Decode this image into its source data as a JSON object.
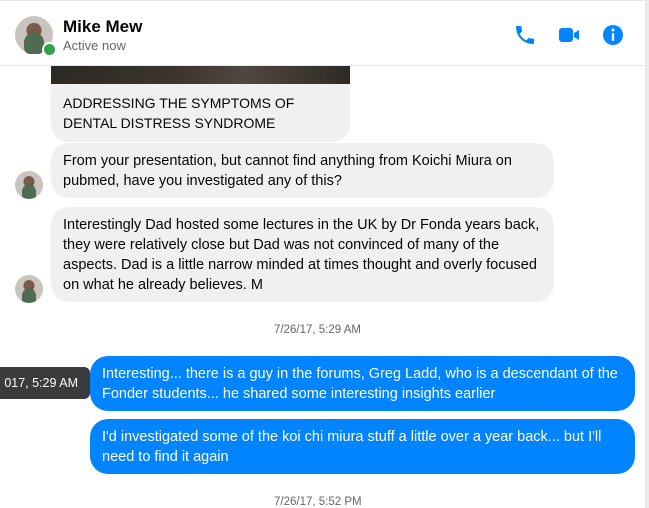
{
  "header": {
    "name": "Mike Mew",
    "status": "Active now",
    "icons": {
      "call": "phone-icon",
      "video": "video-camera-icon",
      "info": "info-icon"
    },
    "accent_color": "#0084ff"
  },
  "messages": {
    "shared_link_caption": "ADDRESSING THE SYMPTOMS OF DENTAL DISTRESS SYNDROME",
    "msg1": "From your presentation, but cannot find anything from Koichi Miura on pubmed, have you investigated any of this?",
    "msg2": "Interestingly Dad hosted some lectures in the UK by Dr Fonda years back, they were relatively close but Dad was not convinced of many of the aspects.  Dad is a little narrow minded at times thought and overly focused on what he already believes. M",
    "timestamp1": "7/26/17, 5:29 AM",
    "tooltip": "017, 5:29 AM",
    "msg3": "Interesting... there is a guy in the forums, Greg Ladd, who is a descendant of the Fonder students... he shared some interesting insights earlier",
    "msg4": "I'd investigated some of the koi chi miura stuff a little over a year back... but I'll need to find it again",
    "timestamp2": "7/26/17, 5:52 PM"
  }
}
